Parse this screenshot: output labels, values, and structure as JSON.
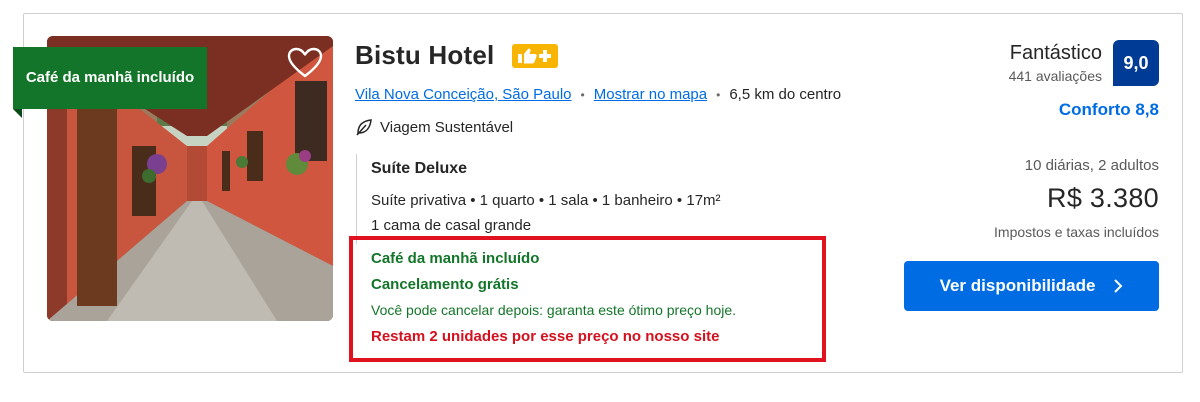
{
  "ribbon": {
    "text": "Café da manhã incluído"
  },
  "hotel": {
    "name": "Bistu Hotel",
    "badge_icon": "thumbs-up-plus-icon",
    "location_link": "Vila Nova Conceição, São Paulo",
    "map_link": "Mostrar no mapa",
    "distance": "6,5 km do centro",
    "sustainable": "Viagem Sustentável"
  },
  "room": {
    "title": "Suíte Deluxe",
    "details": "Suíte privativa • 1 quarto • 1 sala • 1 banheiro • 17m²",
    "bed": "1 cama de casal grande"
  },
  "perks": {
    "breakfast": "Café da manhã incluído",
    "cancel": "Cancelamento grátis",
    "cancel_note": "Você pode cancelar depois: garanta este ótimo preço hoje.",
    "scarcity": "Restam 2 unidades por esse preço no nosso site"
  },
  "rating": {
    "word": "Fantástico",
    "reviews": "441 avaliações",
    "score": "9,0",
    "comfort": "Conforto 8,8"
  },
  "pricing": {
    "stay": "10 diárias, 2 adultos",
    "price": "R$ 3.380",
    "taxes": "Impostos e taxas incluídos"
  },
  "cta": {
    "label": "Ver disponibilidade"
  },
  "colors": {
    "brand_blue": "#006ce4",
    "score_blue": "#003b95",
    "green": "#137529",
    "red": "#d4111e",
    "badge_yellow": "#f7b500"
  }
}
